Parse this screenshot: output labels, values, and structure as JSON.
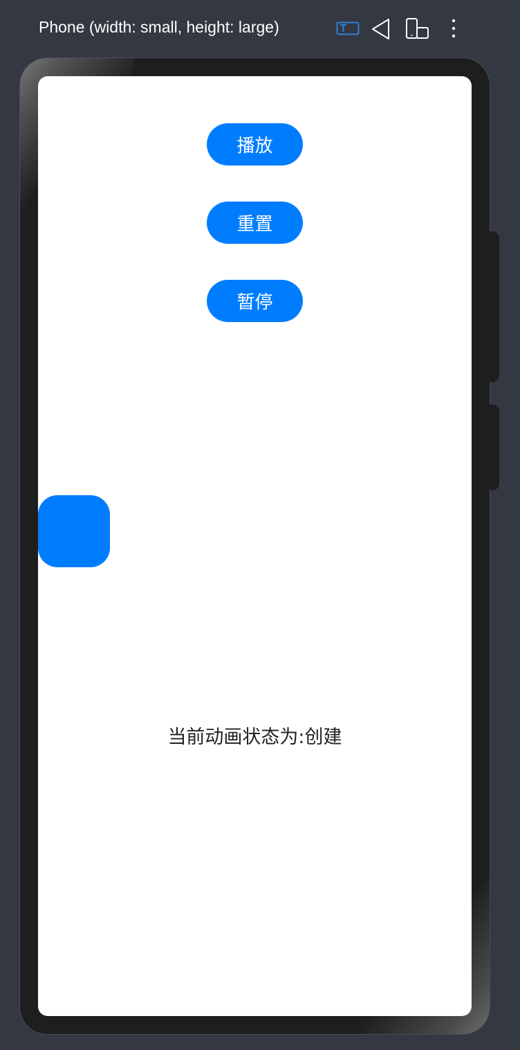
{
  "toolbar": {
    "device_title": "Phone (width: small, height: large)",
    "icons": [
      "text-icon",
      "rotate-icon",
      "fold-icon",
      "more-icon"
    ],
    "accent_color": "#2f7fd8"
  },
  "app": {
    "buttons": {
      "play_label": "播放",
      "reset_label": "重置",
      "pause_label": "暂停"
    },
    "status_text": "当前动画状态为:创建",
    "accent_color": "#007dff"
  }
}
